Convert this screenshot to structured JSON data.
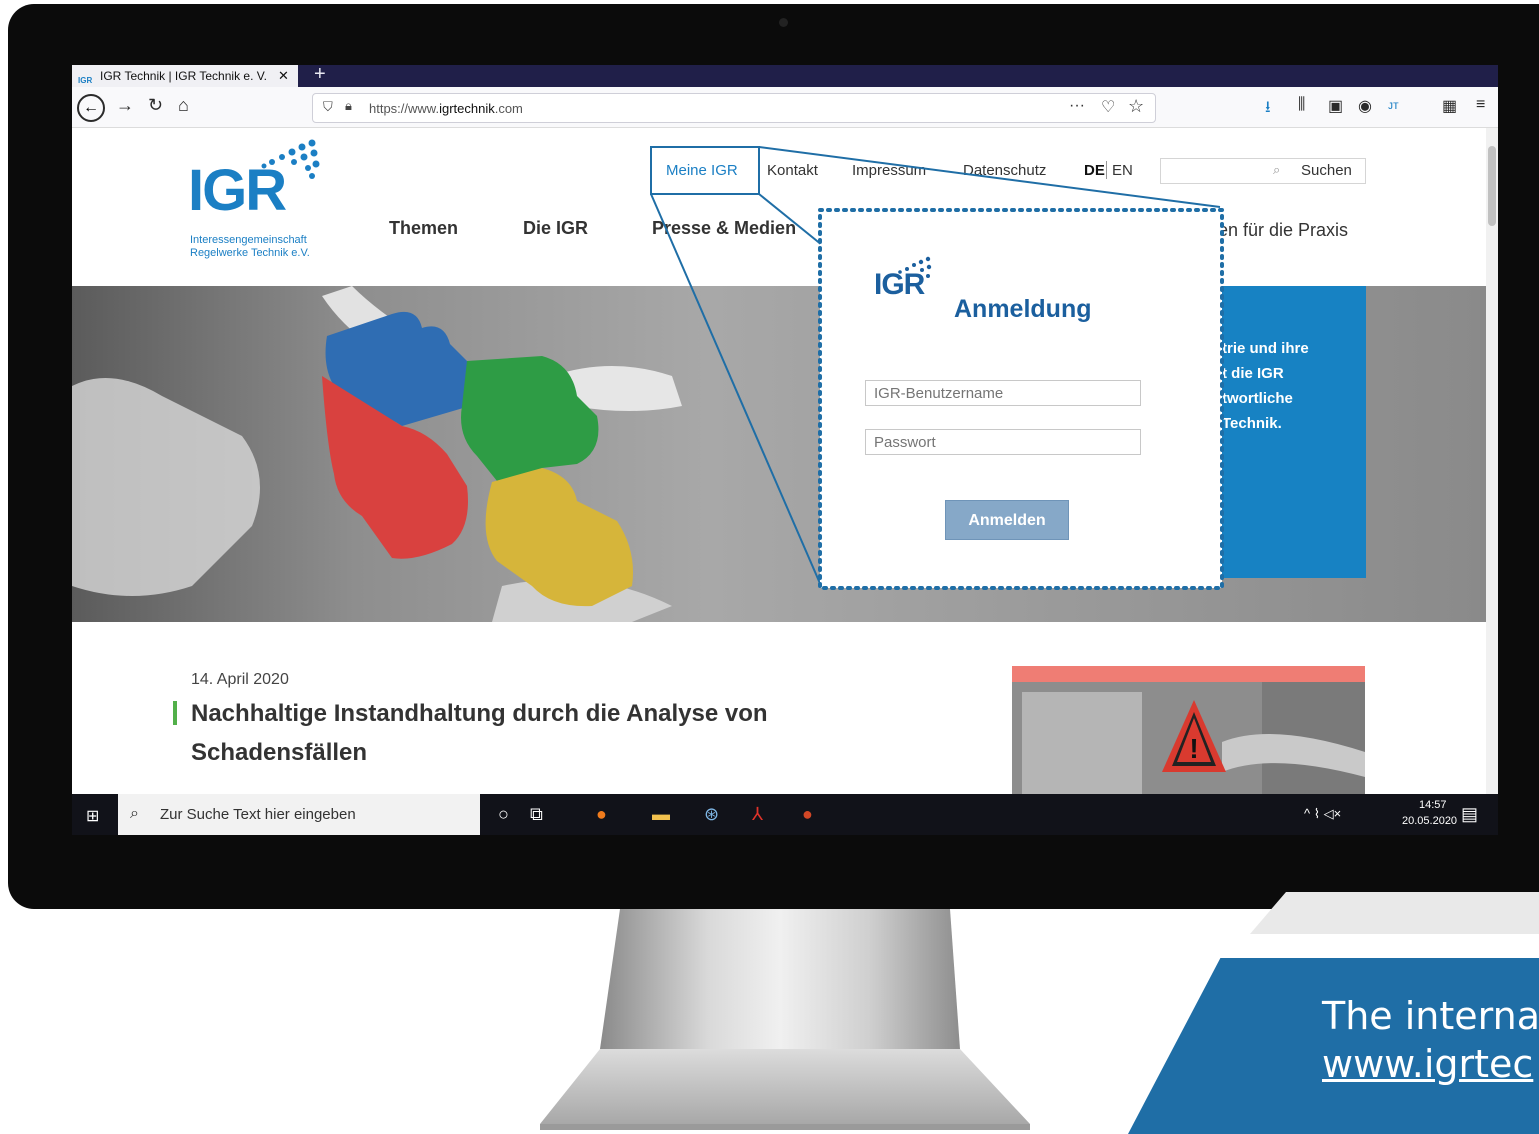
{
  "browser": {
    "tab_title": "IGR Technik | IGR Technik e. V.",
    "tab_favicon": "IGR",
    "url_prefix": "https://www.",
    "url_domain": "igrtechnik",
    "url_suffix": ".com"
  },
  "site": {
    "logo_text": "IGR",
    "logo_sub1": "Interessengemeinschaft",
    "logo_sub2": "Regelwerke Technik e.V.",
    "top_nav": {
      "meine": "Meine IGR",
      "kontakt": "Kontakt",
      "impressum": "Impressum",
      "datenschutz": "Datenschutz",
      "de": "DE",
      "en": "EN"
    },
    "search_label": "Suchen",
    "main_nav": {
      "themen": "Themen",
      "dieigr": "Die IGR",
      "presse": "Presse & Medien",
      "praxis": "en für die Praxis"
    },
    "hero_text": [
      "trie und ihre",
      "t die IGR",
      "twortliche",
      "Technik."
    ],
    "article_date": "14. April 2020",
    "article_title_1": "Nachhaltige Instandhaltung durch die Analyse von",
    "article_title_2": "Schadensfällen"
  },
  "login": {
    "logo": "IGR",
    "title": "Anmeldung",
    "username_placeholder": "IGR-Benutzername",
    "password_placeholder": "Passwort",
    "button": "Anmelden"
  },
  "taskbar": {
    "search_text": "Zur Suche Text hier eingeben",
    "time": "14:57",
    "date": "20.05.2020"
  },
  "promo": {
    "line1": "The interna",
    "line2": "www.igrtec"
  },
  "colors": {
    "brand_blue": "#1b7fc4",
    "popup_blue": "#1b5f9e",
    "accent_green": "#52b04a",
    "promo_blue": "#1f6ea6"
  },
  "icons": {
    "back": "back-arrow-icon",
    "forward": "forward-arrow-icon",
    "reload": "reload-icon",
    "home": "home-icon",
    "download": "download-icon",
    "library": "library-icon",
    "windows": "windows-start-icon",
    "firefox": "firefox-icon",
    "acrobat": "acrobat-icon",
    "powerpoint": "powerpoint-icon",
    "apple": "apple-logo"
  }
}
